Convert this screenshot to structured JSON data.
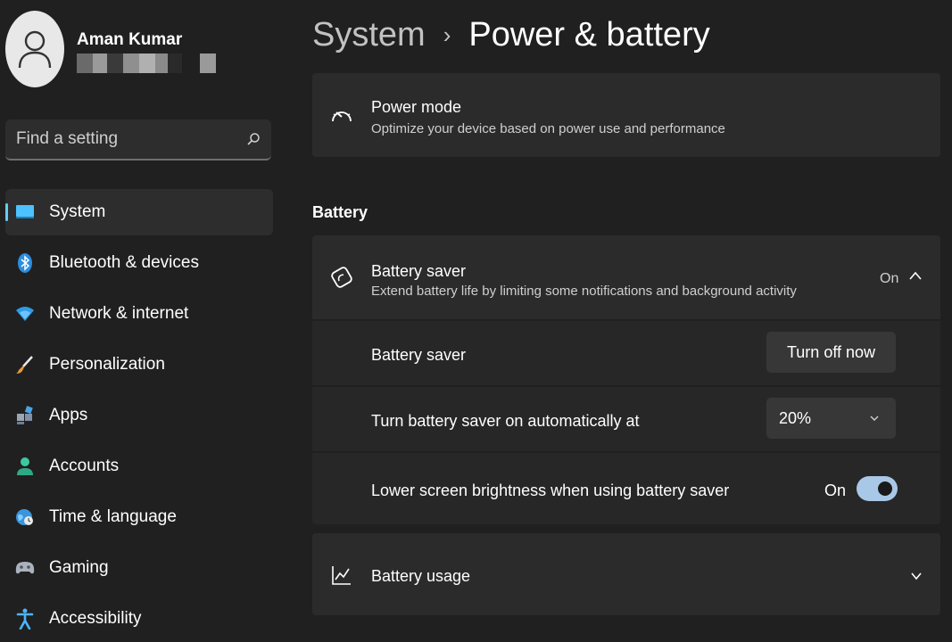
{
  "profile": {
    "name": "Aman Kumar"
  },
  "search": {
    "placeholder": "Find a setting"
  },
  "nav": {
    "items": [
      {
        "label": "System",
        "icon": "system-icon",
        "active": true
      },
      {
        "label": "Bluetooth & devices",
        "icon": "bluetooth-icon"
      },
      {
        "label": "Network & internet",
        "icon": "wifi-icon"
      },
      {
        "label": "Personalization",
        "icon": "brush-icon"
      },
      {
        "label": "Apps",
        "icon": "apps-icon"
      },
      {
        "label": "Accounts",
        "icon": "accounts-icon"
      },
      {
        "label": "Time & language",
        "icon": "globe-clock-icon"
      },
      {
        "label": "Gaming",
        "icon": "gamepad-icon"
      },
      {
        "label": "Accessibility",
        "icon": "accessibility-icon"
      }
    ]
  },
  "breadcrumb": {
    "parent": "System",
    "separator": "›",
    "current": "Power & battery"
  },
  "power_mode": {
    "title": "Power mode",
    "description": "Optimize your device based on power use and performance"
  },
  "battery_section": {
    "title": "Battery"
  },
  "battery_saver": {
    "title": "Battery saver",
    "description": "Extend battery life by limiting some notifications and background activity",
    "status": "On",
    "rows": {
      "saver_label": "Battery saver",
      "turn_off_label": "Turn off now",
      "auto_label": "Turn battery saver on automatically at",
      "auto_value": "20%",
      "brightness_label": "Lower screen brightness when using battery saver",
      "brightness_state": "On"
    }
  },
  "battery_usage": {
    "title": "Battery usage"
  },
  "colors": {
    "background": "#202020",
    "card": "#2b2b2b",
    "accent": "#60cdff",
    "toggle_on": "#a9c7e6"
  }
}
